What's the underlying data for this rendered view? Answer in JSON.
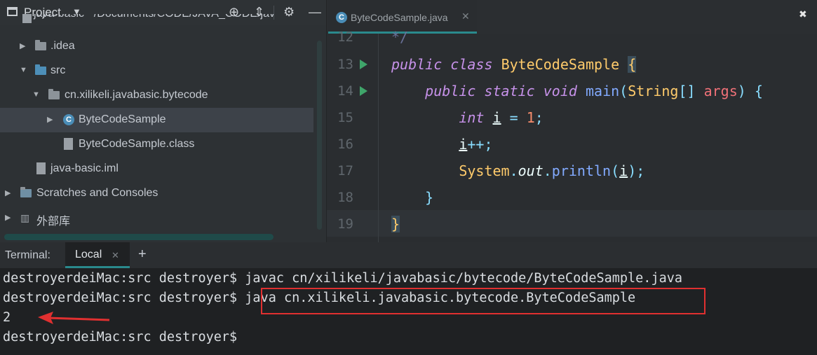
{
  "project": {
    "title": "Project",
    "tree": [
      {
        "label": "java-basic  ~/Documents/CODE/JAVA_CODE/jav"
      },
      {
        "label": ".idea"
      },
      {
        "label": "src"
      },
      {
        "label": "cn.xilikeli.javabasic.bytecode"
      },
      {
        "label": "ByteCodeSample"
      },
      {
        "label": "ByteCodeSample.class"
      },
      {
        "label": "java-basic.iml"
      },
      {
        "label": "Scratches and Consoles"
      },
      {
        "label": "外部库"
      }
    ]
  },
  "editor": {
    "tab_label": "ByteCodeSample.java",
    "line_numbers": [
      "12",
      "13",
      "14",
      "15",
      "16",
      "17",
      "18",
      "19"
    ],
    "code": {
      "l12": "*/",
      "l13": {
        "kw1": "public",
        "kw2": "class",
        "cls": "ByteCodeSample",
        "brace": "{"
      },
      "l14": {
        "kw1": "public",
        "kw2": "static",
        "kw3": "void",
        "fn": "main",
        "p1": "(",
        "cls": "String",
        "arr": "[]",
        "arg": "args",
        "p2": ")",
        "brace": "{"
      },
      "l15": {
        "kw": "int",
        "var": "i",
        "op": "=",
        "num": "1",
        "semi": ";"
      },
      "l16": {
        "var": "i",
        "op": "++",
        "semi": ";"
      },
      "l17": {
        "cls": "System",
        "dot1": ".",
        "fld": "out",
        "dot2": ".",
        "fn": "println",
        "p1": "(",
        "var": "i",
        "p2": ")",
        "semi": ";"
      },
      "l18": "}",
      "l19": "}"
    }
  },
  "terminal": {
    "title": "Terminal:",
    "tab_label": "Local",
    "lines": [
      "destroyerdeiMac:src destroyer$ javac cn/xilikeli/javabasic/bytecode/ByteCodeSample.java",
      "destroyerdeiMac:src destroyer$ java cn.xilikeli.javabasic.bytecode.ByteCodeSample",
      "2",
      "destroyerdeiMac:src destroyer$ "
    ]
  },
  "colors": {
    "accent": "#2a8a8d",
    "annotation_red": "#e03030"
  }
}
